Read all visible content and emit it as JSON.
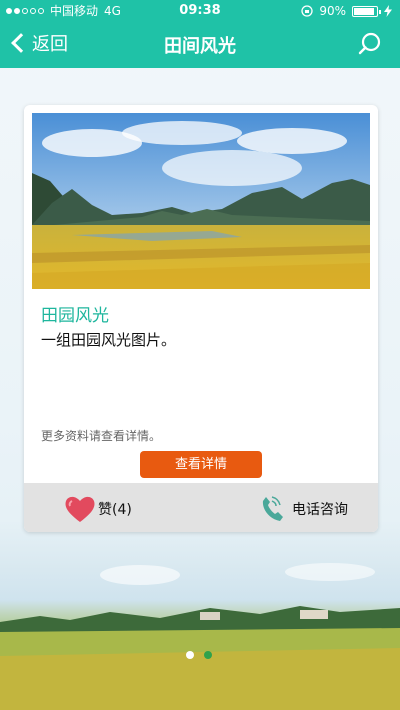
{
  "status_bar": {
    "carrier": "中国移动",
    "network": "4G",
    "time": "09:38",
    "battery": "90%"
  },
  "nav": {
    "back_label": "返回",
    "title": "田间风光"
  },
  "card": {
    "title": "田园风光",
    "description": "一组田园风光图片。",
    "more_text": "更多资料请查看详情。",
    "detail_button": "查看详情",
    "like_label": "赞(4)",
    "call_label": "电话咨询"
  },
  "pager": {
    "count": 2,
    "active_index": 1
  },
  "colors": {
    "accent": "#1fc2a7",
    "button": "#e85a10",
    "title_text": "#1eb69d"
  }
}
